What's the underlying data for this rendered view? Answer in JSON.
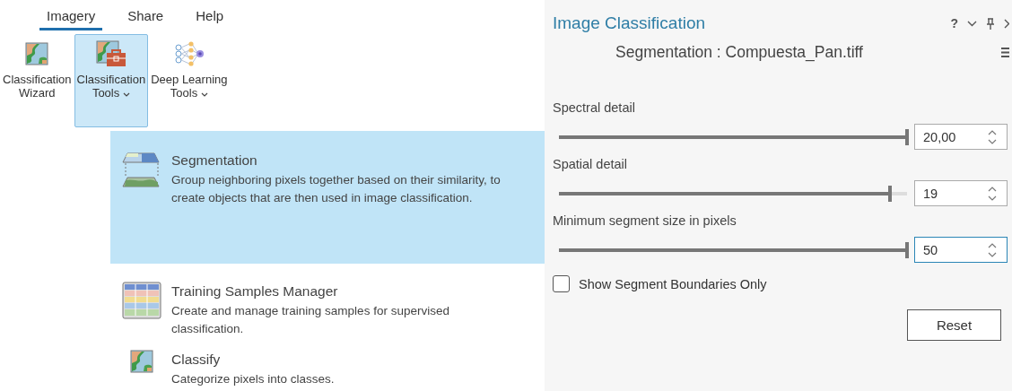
{
  "ribbon": {
    "tabs": [
      {
        "label": "Imagery",
        "selected": true
      },
      {
        "label": "Share",
        "selected": false
      },
      {
        "label": "Help",
        "selected": false
      }
    ],
    "buttons": [
      {
        "lines": [
          "Classification",
          "Wizard"
        ],
        "dropdown": false,
        "selected": false
      },
      {
        "lines": [
          "Classification",
          "Tools"
        ],
        "dropdown": true,
        "selected": true
      },
      {
        "lines": [
          "Deep Learning",
          "Tools"
        ],
        "dropdown": true,
        "selected": false
      }
    ]
  },
  "menu": {
    "items": [
      {
        "title": "Segmentation",
        "description": "Group neighboring pixels together based on their similarity, to create objects that are then used in image classification.",
        "selected": true
      },
      {
        "title": "Training Samples Manager",
        "description": "Create and manage training samples for supervised classification.",
        "selected": false
      },
      {
        "title": "Classify",
        "description": "Categorize pixels into classes.",
        "selected": false
      }
    ]
  },
  "panel": {
    "title": "Image Classification",
    "help": "?",
    "subtitle": "Segmentation : Compuesta_Pan.tiff",
    "parameters": [
      {
        "label": "Spectral detail",
        "level": 1,
        "value": "20,00",
        "focused": false
      },
      {
        "label": "Spatial detail",
        "level": 0.95,
        "value": "19",
        "focused": false
      },
      {
        "label": "Minimum segment size in pixels",
        "level": 1,
        "value": "50",
        "focused": true
      }
    ],
    "checkbox": {
      "label": "Show Segment Boundaries Only",
      "checked": false
    },
    "reset": "Reset"
  }
}
